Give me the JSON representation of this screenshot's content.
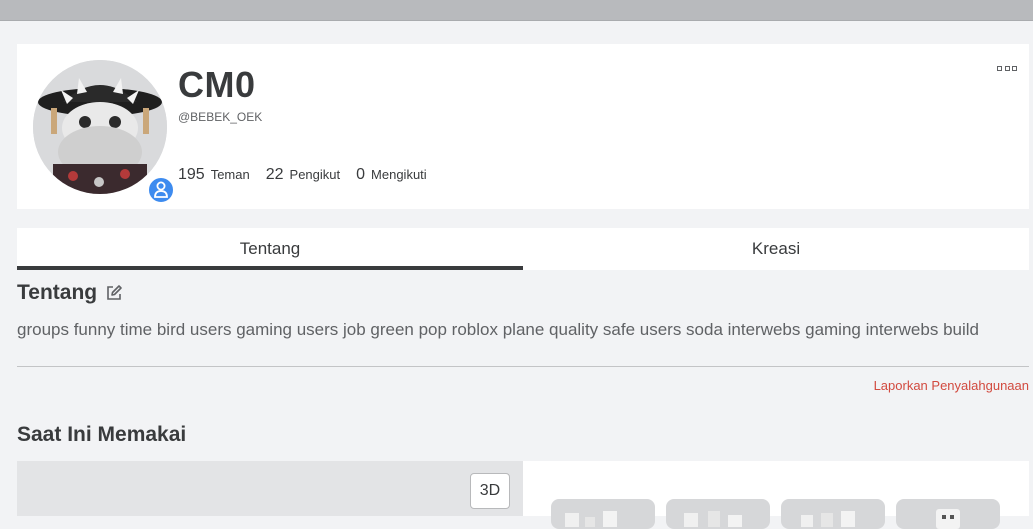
{
  "profile": {
    "display_name": "CM0",
    "username": "@BEBEK_OEK",
    "stats": [
      {
        "value": "195",
        "label": "Teman"
      },
      {
        "value": "22",
        "label": "Pengikut"
      },
      {
        "value": "0",
        "label": "Mengikuti"
      }
    ],
    "presence_color": "#3d8bef"
  },
  "tabs": [
    {
      "label": "Tentang",
      "active": true
    },
    {
      "label": "Kreasi",
      "active": false
    }
  ],
  "about": {
    "title": "Tentang",
    "text": "groups funny time bird users gaming users job green pop roblox plane quality safe users soda interwebs gaming interwebs build"
  },
  "report_link": "Laporkan Penyalahgunaan",
  "wearing": {
    "title": "Saat Ini Memakai",
    "view_3d_label": "3D"
  }
}
